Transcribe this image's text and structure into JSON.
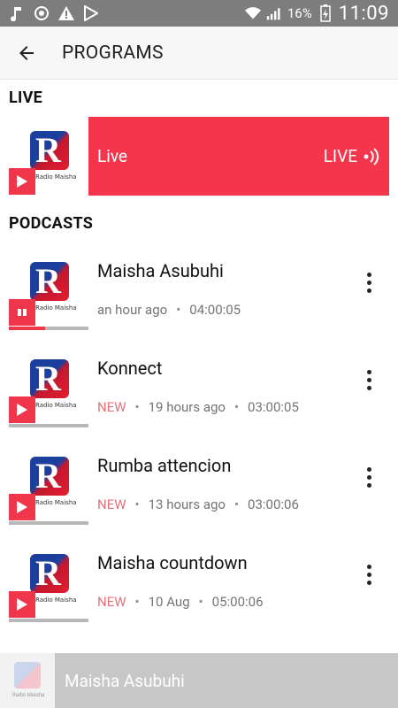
{
  "status_bar": {
    "battery": "16%",
    "time": "11:09"
  },
  "app_bar": {
    "title": "PROGRAMS"
  },
  "live_section": {
    "heading": "LIVE",
    "thumbnail_text": "Radio Maisha",
    "card_title": "Live",
    "badge": "LIVE"
  },
  "podcasts_section": {
    "heading": "PODCASTS",
    "items": [
      {
        "title": "Maisha Asubuhi",
        "new": "",
        "age": "an hour ago",
        "duration": "04:00:05",
        "thumb_text": "Radio Maisha",
        "playing": true,
        "progress": 0.45
      },
      {
        "title": "Konnect",
        "new": "NEW",
        "age": "19 hours ago",
        "duration": "03:00:05",
        "thumb_text": "Radio Maisha",
        "playing": false,
        "progress": 0
      },
      {
        "title": "Rumba attencion",
        "new": "NEW",
        "age": "13 hours ago",
        "duration": "03:00:06",
        "thumb_text": "Radio Maisha",
        "playing": false,
        "progress": 0
      },
      {
        "title": "Maisha countdown",
        "new": "NEW",
        "age": "10 Aug",
        "duration": "05:00:06",
        "thumb_text": "Radio Maisha",
        "playing": false,
        "progress": 0
      }
    ]
  },
  "mini_player": {
    "title": "Maisha Asubuhi",
    "thumb_text": "Radio Maisha"
  },
  "colors": {
    "accent": "#f4354b",
    "status_bar": "#7d7d7d",
    "new_label": "#e0727a",
    "player_bg": "#c7c7c7"
  }
}
